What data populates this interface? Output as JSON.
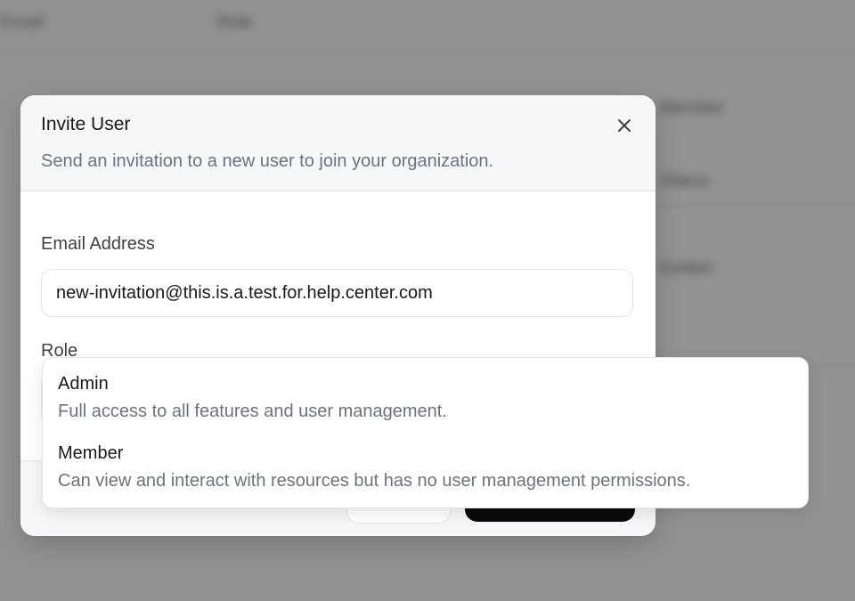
{
  "background": {
    "texts": [
      "Email",
      "Role",
      "Status",
      "Invited",
      "Member"
    ]
  },
  "dialog": {
    "title": "Invite User",
    "description": "Send an invitation to a new user to join your organization.",
    "close_icon": "close-icon",
    "email_label": "Email Address",
    "email_value": "new-invitation@this.is.a.test.for.help.center.com",
    "role_label": "Role"
  },
  "role_dropdown": {
    "options": [
      {
        "title": "Admin",
        "description": "Full access to all features and user management."
      },
      {
        "title": "Member",
        "description": "Can view and interact with resources but has no user management permissions."
      }
    ]
  },
  "colors": {
    "overlay": "#8f8f8f",
    "primary_button": "#0a0a0a",
    "muted_text": "#6b7280"
  }
}
